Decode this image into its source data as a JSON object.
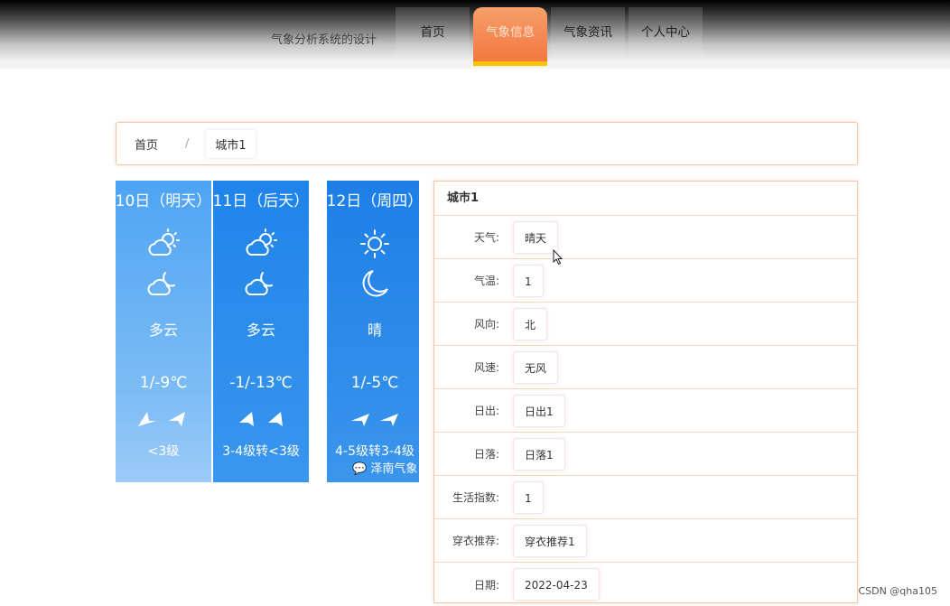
{
  "header": {
    "site_title": "气象分析系统的设计",
    "nav": [
      {
        "label": "首页",
        "active": false
      },
      {
        "label": "气象信息",
        "active": true
      },
      {
        "label": "气象资讯",
        "active": false
      },
      {
        "label": "个人中心",
        "active": false
      }
    ]
  },
  "breadcrumb": {
    "home": "首页",
    "separator": "/",
    "current": "城市1"
  },
  "forecast": [
    {
      "date": "10日（明天）",
      "icon_day": "partly-cloudy-icon",
      "icon_night": "cloudy-night-icon",
      "condition": "多云",
      "temp": "1/-9℃",
      "wind_level": "<3级"
    },
    {
      "date": "11日（后天）",
      "icon_day": "partly-cloudy-icon",
      "icon_night": "cloudy-night-icon",
      "condition": "多云",
      "temp": "-1/-13℃",
      "wind_level": "3-4级转<3级"
    },
    {
      "date": "12日（周四）",
      "icon_day": "sun-icon",
      "icon_night": "moon-icon",
      "condition": "晴",
      "temp": "1/-5℃",
      "wind_level": "4-5级转3-4级"
    }
  ],
  "forecast_watermark": "泽南气象",
  "detail": {
    "title": "城市1",
    "rows": [
      {
        "label": "天气:",
        "value": "晴天"
      },
      {
        "label": "气温:",
        "value": "1"
      },
      {
        "label": "风向:",
        "value": "北"
      },
      {
        "label": "风速:",
        "value": "无风"
      },
      {
        "label": "日出:",
        "value": "日出1"
      },
      {
        "label": "日落:",
        "value": "日落1"
      },
      {
        "label": "生活指数:",
        "value": "1"
      },
      {
        "label": "穿衣推荐:",
        "value": "穿衣推荐1"
      },
      {
        "label": "日期:",
        "value": "2022-04-23"
      }
    ]
  },
  "watermark": "CSDN @qha105"
}
